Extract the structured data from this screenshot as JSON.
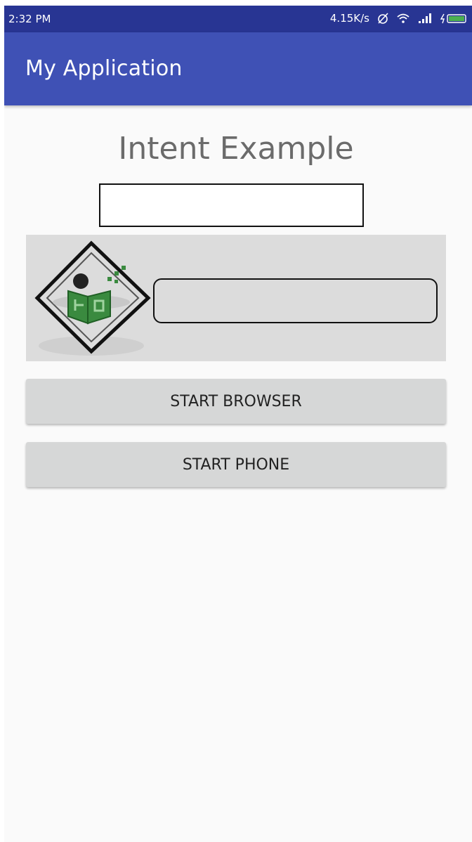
{
  "status_bar": {
    "time": "2:32 PM",
    "network_speed": "4.15K/s",
    "icons": [
      "alarm-off-icon",
      "wifi-icon",
      "signal-icon",
      "battery-charging-icon"
    ]
  },
  "app_bar": {
    "title": "My Application"
  },
  "main": {
    "heading": "Intent Example",
    "logo_icon": "tutorialspoint-logo",
    "buttons": {
      "browser_label": "START BROWSER",
      "phone_label": "START PHONE"
    }
  },
  "colors": {
    "status_bar": "#283593",
    "app_bar": "#3f51b5",
    "background": "#fafafa",
    "button": "#d6d7d7",
    "logo_green": "#3a8a3f"
  }
}
